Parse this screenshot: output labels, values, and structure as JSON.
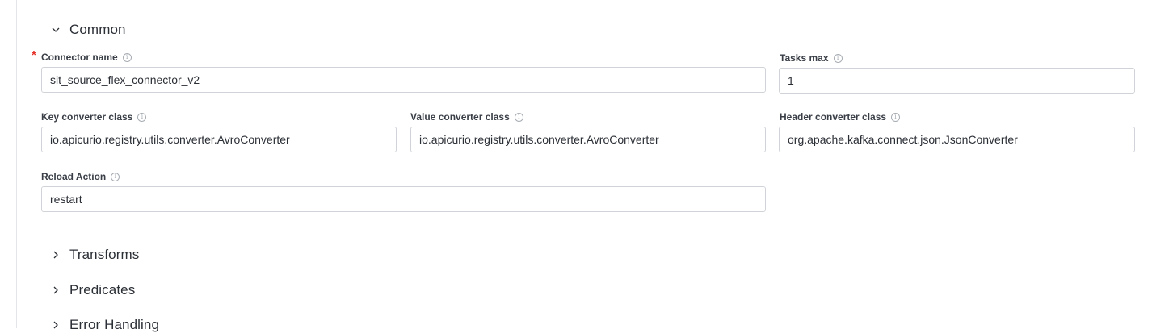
{
  "sections": {
    "common": {
      "title": "Common",
      "icon": "chevron-down-icon"
    },
    "transforms": {
      "title": "Transforms",
      "icon": "chevron-right-icon"
    },
    "predicates": {
      "title": "Predicates",
      "icon": "chevron-right-icon"
    },
    "error_handling": {
      "title": "Error Handling",
      "icon": "chevron-right-icon"
    }
  },
  "fields": {
    "connector_name": {
      "label": "Connector name",
      "value": "sit_source_flex_connector_v2",
      "required_mark": "*"
    },
    "tasks_max": {
      "label": "Tasks max",
      "value": "1"
    },
    "key_converter": {
      "label": "Key converter class",
      "value": "io.apicurio.registry.utils.converter.AvroConverter"
    },
    "value_converter": {
      "label": "Value converter class",
      "value": "io.apicurio.registry.utils.converter.AvroConverter"
    },
    "header_converter": {
      "label": "Header converter class",
      "value": "org.apache.kafka.connect.json.JsonConverter"
    },
    "reload_action": {
      "label": "Reload Action",
      "value": "restart"
    }
  },
  "info_glyph": "i",
  "colors": {
    "required": "#e5322b",
    "border": "#d0d4d9",
    "text": "#2b2f36"
  }
}
